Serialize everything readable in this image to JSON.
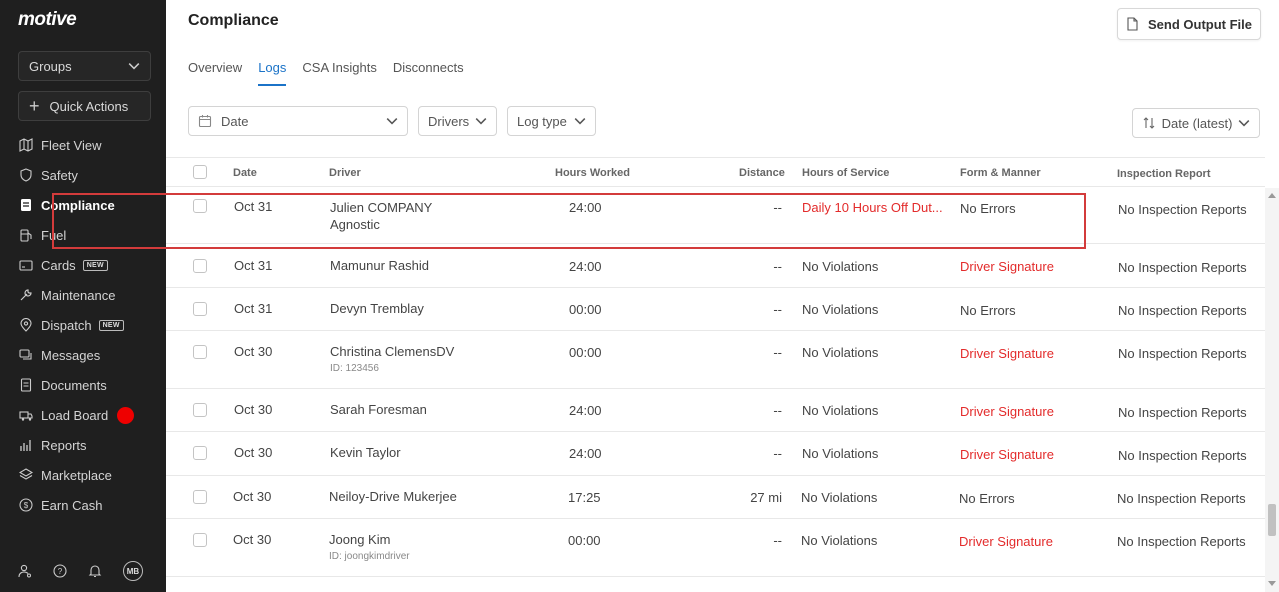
{
  "brand": {
    "logo": "motive"
  },
  "sidebar": {
    "groups_label": "Groups",
    "quick_actions_label": "Quick Actions",
    "items": [
      {
        "label": "Fleet View",
        "icon": "map-icon",
        "active": false
      },
      {
        "label": "Safety",
        "icon": "shield-icon",
        "active": false
      },
      {
        "label": "Compliance",
        "icon": "document-icon",
        "active": true
      },
      {
        "label": "Fuel",
        "icon": "fuel-icon",
        "active": false
      },
      {
        "label": "Cards",
        "icon": "card-icon",
        "active": false,
        "badge": "NEW"
      },
      {
        "label": "Maintenance",
        "icon": "wrench-icon",
        "active": false
      },
      {
        "label": "Dispatch",
        "icon": "location-icon",
        "active": false,
        "badge": "NEW"
      },
      {
        "label": "Messages",
        "icon": "messages-icon",
        "active": false
      },
      {
        "label": "Documents",
        "icon": "documents-icon",
        "active": false
      },
      {
        "label": "Load Board",
        "icon": "truck-icon",
        "active": false,
        "dot": true
      },
      {
        "label": "Reports",
        "icon": "reports-icon",
        "active": false
      },
      {
        "label": "Marketplace",
        "icon": "layers-icon",
        "active": false
      },
      {
        "label": "Earn Cash",
        "icon": "dollar-icon",
        "active": false
      }
    ],
    "avatar_initials": "MB"
  },
  "header": {
    "title": "Compliance",
    "send_output_label": "Send Output File"
  },
  "tabs": [
    {
      "label": "Overview",
      "active": false
    },
    {
      "label": "Logs",
      "active": true
    },
    {
      "label": "CSA Insights",
      "active": false
    },
    {
      "label": "Disconnects",
      "active": false
    }
  ],
  "filters": {
    "date_placeholder": "Date",
    "drivers_label": "Drivers",
    "log_type_label": "Log type",
    "sort_label": "Date (latest)"
  },
  "table": {
    "columns": [
      "Date",
      "Driver",
      "Hours Worked",
      "Distance",
      "Hours of Service",
      "Form & Manner",
      "Inspection Report"
    ],
    "rows": [
      {
        "date": "Oct 31",
        "driver": "Julien COMPANY",
        "driver_line2": "Agnostic",
        "hours": "24:00",
        "distance": "--",
        "hos": "Daily 10 Hours Off Dut...",
        "hos_error": true,
        "form": "No Errors",
        "form_error": false,
        "inspection": "No Inspection Reports"
      },
      {
        "date": "Oct 31",
        "driver": "Mamunur Rashid",
        "hours": "24:00",
        "distance": "--",
        "hos": "No Violations",
        "hos_error": false,
        "form": "Driver Signature",
        "form_error": true,
        "inspection": "No Inspection Reports"
      },
      {
        "date": "Oct 31",
        "driver": "Devyn Tremblay",
        "hours": "00:00",
        "distance": "--",
        "hos": "No Violations",
        "hos_error": false,
        "form": "No Errors",
        "form_error": false,
        "inspection": "No Inspection Reports"
      },
      {
        "date": "Oct 30",
        "driver": "Christina ClemensDV",
        "sub": "ID: 123456",
        "hours": "00:00",
        "distance": "--",
        "hos": "No Violations",
        "hos_error": false,
        "form": "Driver Signature",
        "form_error": true,
        "inspection": "No Inspection Reports"
      },
      {
        "date": "Oct 30",
        "driver": "Sarah Foresman",
        "hours": "24:00",
        "distance": "--",
        "hos": "No Violations",
        "hos_error": false,
        "form": "Driver Signature",
        "form_error": true,
        "inspection": "No Inspection Reports"
      },
      {
        "date": "Oct 30",
        "driver": "Kevin Taylor",
        "hours": "24:00",
        "distance": "--",
        "hos": "No Violations",
        "hos_error": false,
        "form": "Driver Signature",
        "form_error": true,
        "inspection": "No Inspection Reports"
      },
      {
        "date": "Oct 30",
        "driver": "Neiloy-Drive Mukerjee",
        "hours": "17:25",
        "distance": "27 mi",
        "hos": "No Violations",
        "hos_error": false,
        "form": "No Errors",
        "form_error": false,
        "inspection": "No Inspection Reports"
      },
      {
        "date": "Oct 30",
        "driver": "Joong Kim",
        "sub": "ID: joongkimdriver",
        "hours": "00:00",
        "distance": "--",
        "hos": "No Violations",
        "hos_error": false,
        "form": "Driver Signature",
        "form_error": true,
        "inspection": "No Inspection Reports"
      }
    ]
  },
  "colors": {
    "accent": "#1b73c8",
    "error": "#e32b2b",
    "sidebar_bg": "#1f1f1f",
    "highlight": "#d33b3b",
    "dot": "#ee0000"
  }
}
